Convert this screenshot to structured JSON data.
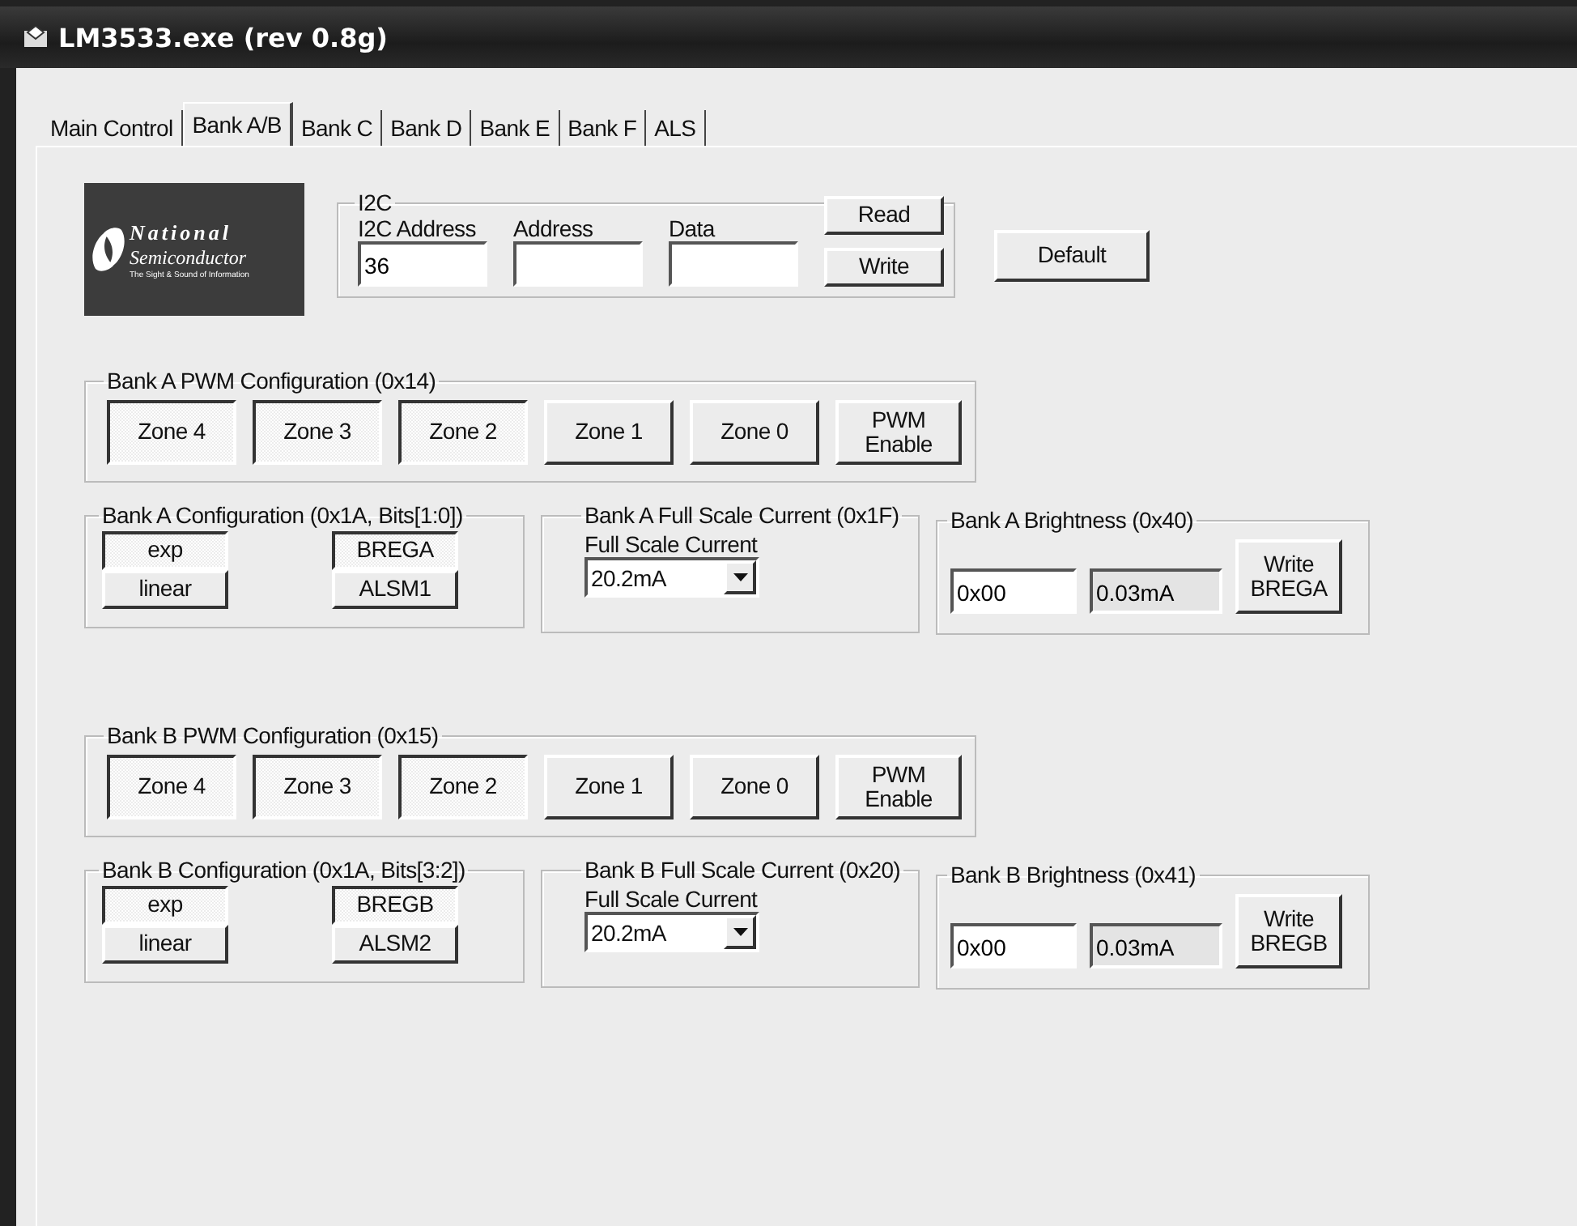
{
  "window": {
    "title": "LM3533.exe (rev 0.8g)"
  },
  "tabs": [
    {
      "label": "Main Control",
      "selected": false
    },
    {
      "label": "Bank A/B",
      "selected": true
    },
    {
      "label": "Bank C",
      "selected": false
    },
    {
      "label": "Bank D",
      "selected": false
    },
    {
      "label": "Bank E",
      "selected": false
    },
    {
      "label": "Bank F",
      "selected": false
    },
    {
      "label": "ALS",
      "selected": false
    }
  ],
  "logo": {
    "line_1": "National",
    "line_2": "Semiconductor",
    "tagline": "The Sight & Sound of Information"
  },
  "i2c": {
    "title": "I2C",
    "fields": [
      {
        "label": "I2C Address",
        "value": "36"
      },
      {
        "label": "Address"
      },
      {
        "label": "Data"
      }
    ],
    "buttons": [
      "Read",
      "Write"
    ]
  },
  "default_button": "Default",
  "banks": [
    {
      "pwm": {
        "title": "Bank A PWM Configuration (0x14)",
        "zones": [
          {
            "label": "Zone 4",
            "selected": true
          },
          {
            "label": "Zone 3",
            "selected": true
          },
          {
            "label": "Zone 2",
            "selected": true
          },
          {
            "label": "Zone 1",
            "selected": false
          },
          {
            "label": "Zone 0",
            "selected": false
          },
          {
            "label": "PWM Enable",
            "selected": false
          }
        ]
      },
      "config": {
        "title": "Bank A Configuration (0x1A, Bits[1:0])",
        "modes": [
          {
            "label": "exp",
            "selected": true
          },
          {
            "label": "linear",
            "selected": false
          }
        ],
        "sources": [
          {
            "label": "BREGA",
            "selected": true
          },
          {
            "label": "ALSM1",
            "selected": false
          }
        ]
      },
      "full_scale": {
        "title": "Bank A Full Scale Current (0x1F)",
        "label": "Full Scale Current",
        "value": "20.2mA"
      },
      "brightness": {
        "title": "Bank A Brightness (0x40)",
        "value": "0x00",
        "reading": "0.03mA",
        "button": "Write BREGA"
      }
    },
    {
      "pwm": {
        "title": "Bank B PWM Configuration (0x15)",
        "zones": [
          {
            "label": "Zone 4",
            "selected": true
          },
          {
            "label": "Zone 3",
            "selected": true
          },
          {
            "label": "Zone 2",
            "selected": true
          },
          {
            "label": "Zone 1",
            "selected": false
          },
          {
            "label": "Zone 0",
            "selected": false
          },
          {
            "label": "PWM Enable",
            "selected": false
          }
        ]
      },
      "config": {
        "title": "Bank B Configuration (0x1A, Bits[3:2])",
        "modes": [
          {
            "label": "exp",
            "selected": true
          },
          {
            "label": "linear",
            "selected": false
          }
        ],
        "sources": [
          {
            "label": "BREGB",
            "selected": true
          },
          {
            "label": "ALSM2",
            "selected": false
          }
        ]
      },
      "full_scale": {
        "title": "Bank B Full Scale Current (0x20)",
        "label": "Full Scale Current",
        "value": "20.2mA"
      },
      "brightness": {
        "title": "Bank B Brightness (0x41)",
        "value": "0x00",
        "reading": "0.03mA",
        "button": "Write BREGB"
      }
    }
  ]
}
